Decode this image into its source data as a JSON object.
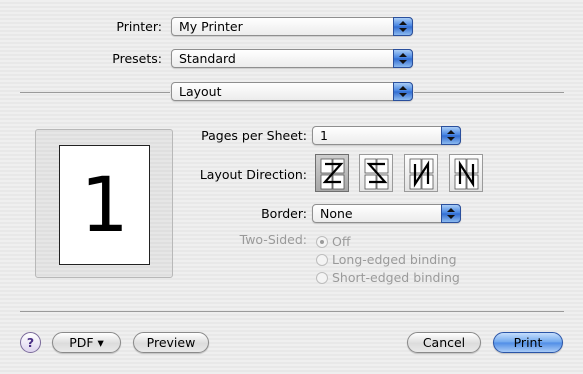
{
  "printer": {
    "label": "Printer:",
    "value": "My Printer"
  },
  "presets": {
    "label": "Presets:",
    "value": "Standard"
  },
  "panel_selector": {
    "value": "Layout"
  },
  "layout": {
    "preview_page_number": "1",
    "pages_per_sheet": {
      "label": "Pages per Sheet:",
      "value": "1"
    },
    "layout_direction": {
      "label": "Layout Direction:",
      "selected_index": 0,
      "options": [
        "z-order-icon",
        "reverse-z-order-icon",
        "down-then-right-icon",
        "down-then-left-icon"
      ]
    },
    "border": {
      "label": "Border:",
      "value": "None"
    },
    "two_sided": {
      "label": "Two-Sided:",
      "options": [
        "Off",
        "Long-edged binding",
        "Short-edged binding"
      ],
      "selected": "Off",
      "enabled": false
    }
  },
  "footer": {
    "help": "?",
    "pdf": "PDF ▾",
    "preview": "Preview",
    "cancel": "Cancel",
    "print": "Print"
  }
}
